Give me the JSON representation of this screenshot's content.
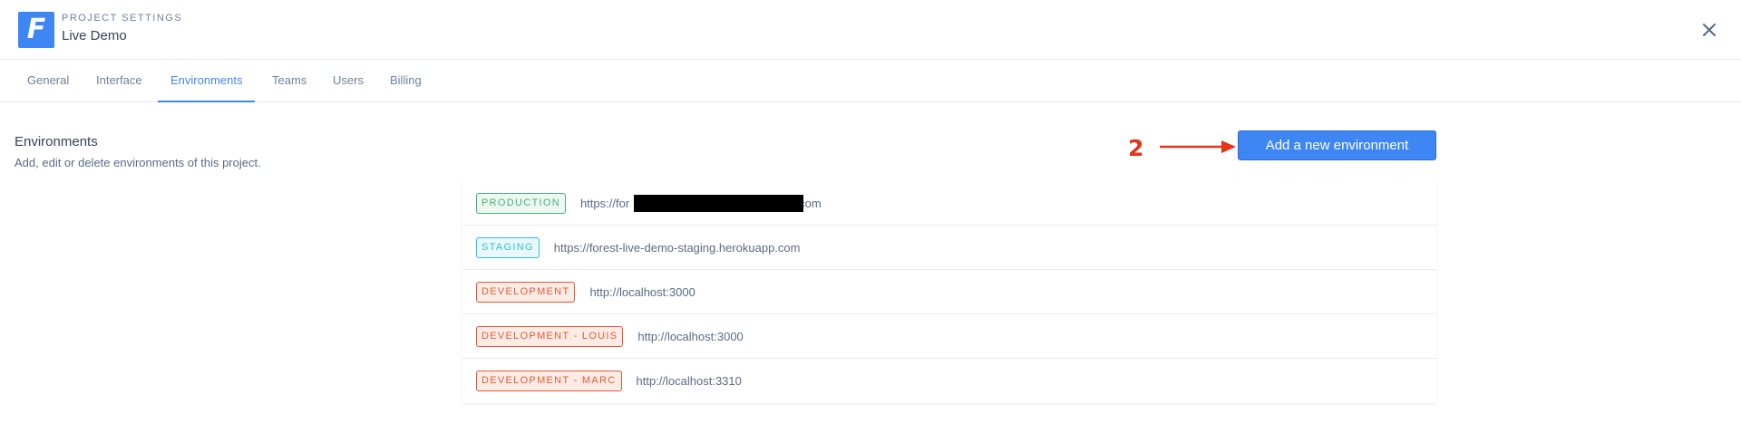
{
  "header": {
    "logo_letter": "F",
    "subtitle": "PROJECT SETTINGS",
    "title": "Live Demo"
  },
  "tabs": [
    {
      "label": "General"
    },
    {
      "label": "Interface"
    },
    {
      "label": "Environments",
      "active": true
    },
    {
      "label": "Teams"
    },
    {
      "label": "Users"
    },
    {
      "label": "Billing"
    }
  ],
  "section": {
    "title": "Environments",
    "description": "Add, edit or delete environments of this project."
  },
  "annotation": {
    "number": "2",
    "color": "#e53418"
  },
  "add_button": {
    "label": "Add a new environment"
  },
  "environments": [
    {
      "name": "PRODUCTION",
      "url": "https://for",
      "url_suffix": "com",
      "redacted": true,
      "color": "#44b277"
    },
    {
      "name": "STAGING",
      "url": "https://forest-live-demo-staging.herokuapp.com",
      "color": "#2cc0e6"
    },
    {
      "name": "DEVELOPMENT",
      "url": "http://localhost:3000",
      "color": "#e25a36"
    },
    {
      "name": "DEVELOPMENT - LOUIS",
      "url": "http://localhost:3000",
      "color": "#e25a36"
    },
    {
      "name": "DEVELOPMENT - MARC",
      "url": "http://localhost:3310",
      "color": "#e25a36"
    }
  ],
  "colors": {
    "accent": "#3f86f5",
    "text": "#415574"
  }
}
